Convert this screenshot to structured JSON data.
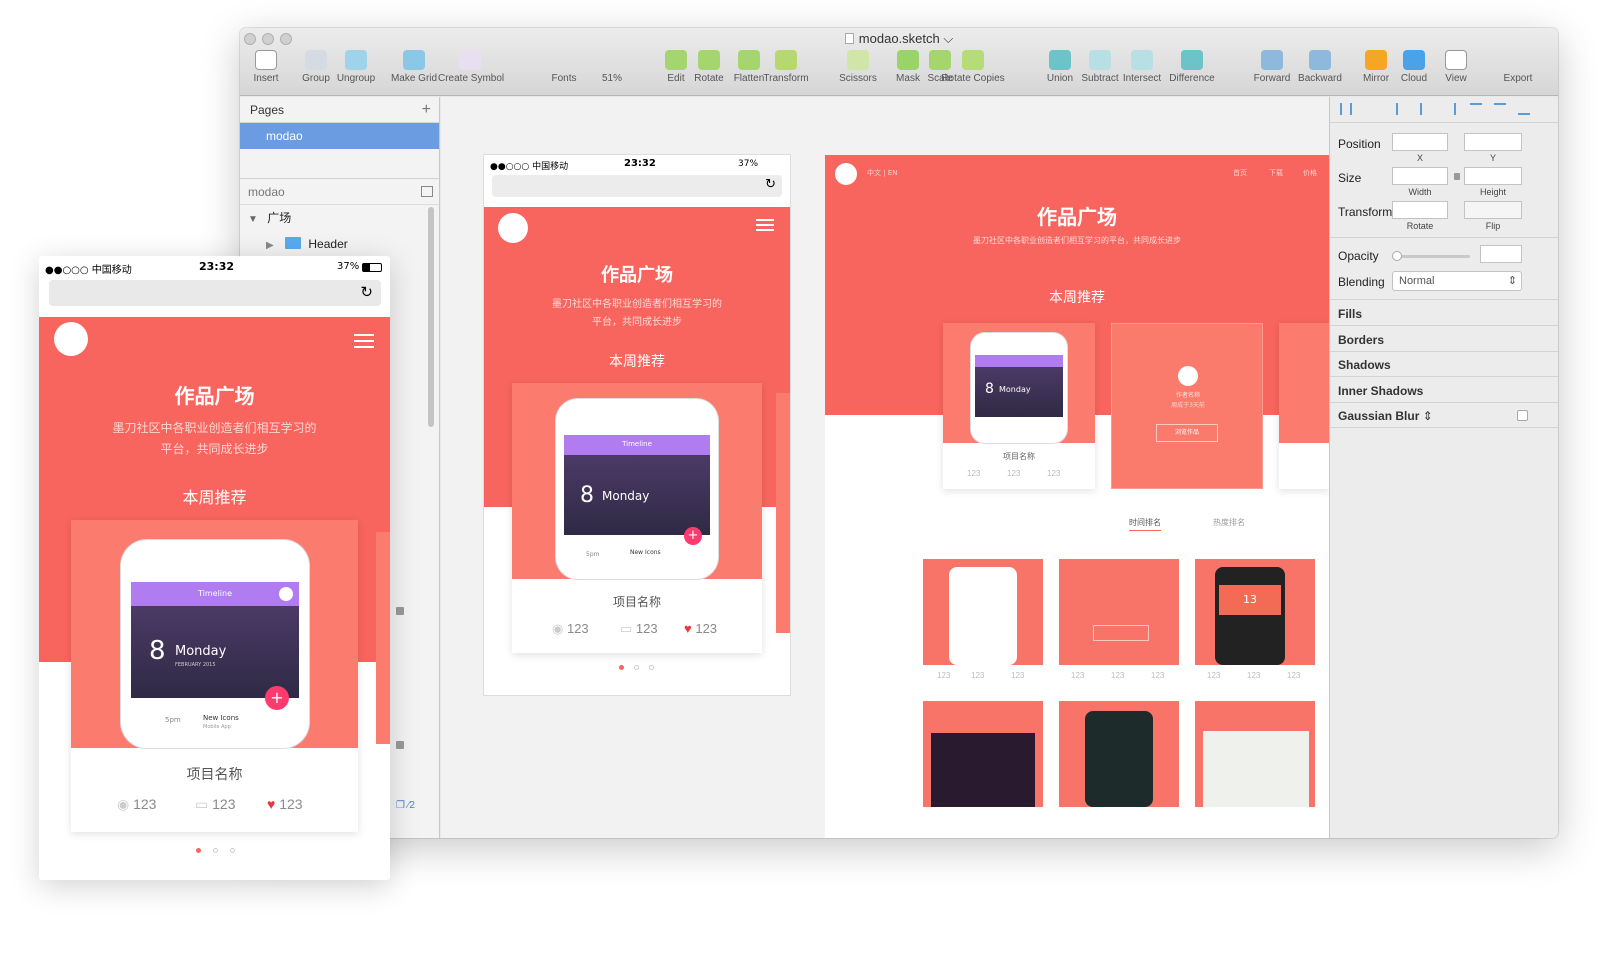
{
  "window": {
    "title": "modao.sketch",
    "toolbar": [
      {
        "label": "Insert",
        "icon": "plus-icon"
      },
      {
        "label": "Group",
        "icon": "group-icon"
      },
      {
        "label": "Ungroup",
        "icon": "ungroup-icon"
      },
      {
        "label": "Make Grid",
        "icon": "grid-icon"
      },
      {
        "label": "Create Symbol",
        "icon": "symbol-icon"
      },
      {
        "label": "Fonts",
        "icon": "font-icon"
      },
      {
        "label": "51%",
        "icon": "zoom-icon"
      },
      {
        "label": "Edit",
        "icon": "edit-icon"
      },
      {
        "label": "Rotate",
        "icon": "rotate-icon"
      },
      {
        "label": "Flatten",
        "icon": "flatten-icon"
      },
      {
        "label": "Transform",
        "icon": "transform-icon"
      },
      {
        "label": "Scissors",
        "icon": "scissors-icon"
      },
      {
        "label": "Mask",
        "icon": "mask-icon"
      },
      {
        "label": "Scale",
        "icon": "scale-icon"
      },
      {
        "label": "Rotate Copies",
        "icon": "rotate-copies-icon"
      },
      {
        "label": "Union",
        "icon": "union-icon"
      },
      {
        "label": "Subtract",
        "icon": "subtract-icon"
      },
      {
        "label": "Intersect",
        "icon": "intersect-icon"
      },
      {
        "label": "Difference",
        "icon": "difference-icon"
      },
      {
        "label": "Forward",
        "icon": "forward-icon"
      },
      {
        "label": "Backward",
        "icon": "backward-icon"
      },
      {
        "label": "Mirror",
        "icon": "mirror-icon"
      },
      {
        "label": "Cloud",
        "icon": "cloud-icon"
      },
      {
        "label": "View",
        "icon": "view-icon"
      },
      {
        "label": "Export",
        "icon": "export-icon"
      }
    ]
  },
  "sidebar": {
    "pages_label": "Pages",
    "add": "+",
    "page": "modao",
    "artboard": "modao",
    "layer_group": "广场",
    "layer_child": "Header",
    "footer_count": "2"
  },
  "inspector": {
    "position": "Position",
    "x": "X",
    "y": "Y",
    "size": "Size",
    "width": "Width",
    "height": "Height",
    "transform": "Transform",
    "rotate": "Rotate",
    "flip": "Flip",
    "opacity": "Opacity",
    "blending": "Blending",
    "blending_value": "Normal",
    "fills": "Fills",
    "borders": "Borders",
    "shadows": "Shadows",
    "inner_shadows": "Inner Shadows",
    "gaussian_blur": "Gaussian Blur"
  },
  "mobile": {
    "carrier": "●●○○○ 中国移动",
    "time": "23:32",
    "battery": "37%",
    "title": "作品广场",
    "subtitle1": "墨刀社区中各职业创造者们相互学习的",
    "subtitle2": "平台，共同成长进步",
    "week": "本周推荐",
    "timeline": "Timeline",
    "day_num": "8",
    "day": "Monday",
    "month": "FEBRUARY 2015",
    "slot_time": "5pm",
    "slot_title": "New Icons",
    "slot_sub": "Mobile App",
    "project": "项目名称",
    "views": "123",
    "comments": "123",
    "likes": "123"
  },
  "web": {
    "lang": "中文 | EN",
    "nav": [
      "首页",
      "下载",
      "价格"
    ],
    "title": "作品广场",
    "subtitle": "墨刀社区中各职业创造者们相互学习的平台，共同成长进步",
    "week": "本周推荐",
    "project": "项目名称",
    "author": "作者名称",
    "author_sub": "周成于3天前",
    "browse": "浏览作品",
    "tab_time": "时间排名",
    "tab_hot": "热度排名",
    "thumb_date": "13",
    "stat": "123"
  }
}
